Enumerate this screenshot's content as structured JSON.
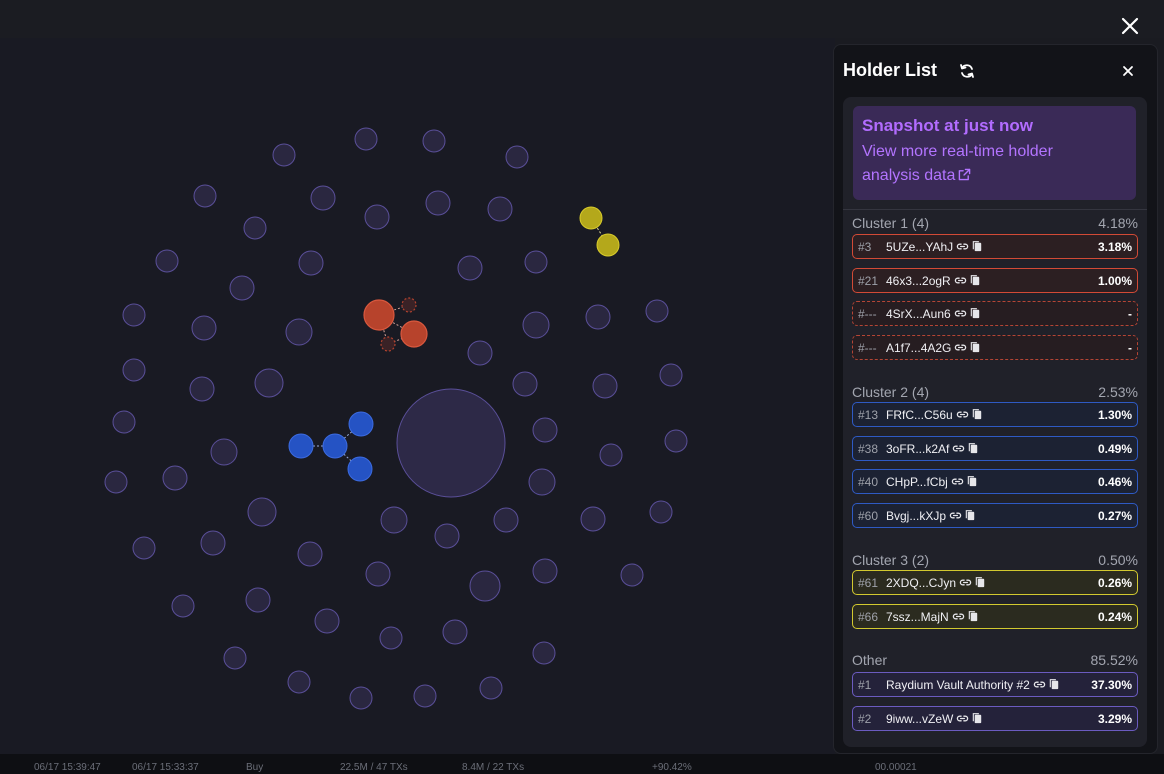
{
  "panel": {
    "title": "Holder List"
  },
  "snapshot": {
    "title": "Snapshot at just now",
    "link_text": "View more real-time holder analysis data"
  },
  "clusters": [
    {
      "label": "Cluster 1 (4)",
      "pct": "4.18%",
      "color": "#d24a36",
      "holders": [
        {
          "rank": "#3",
          "address": "5UZe...YAhJ",
          "value": "3.18%",
          "style": "red"
        },
        {
          "rank": "#21",
          "address": "46x3...2ogR",
          "value": "1.00%",
          "style": "red"
        },
        {
          "rank": "#---",
          "address": "4SrX...Aun6",
          "value": "-",
          "style": "red-dash"
        },
        {
          "rank": "#---",
          "address": "A1f7...4A2G",
          "value": "-",
          "style": "red-dash"
        }
      ]
    },
    {
      "label": "Cluster 2 (4)",
      "pct": "2.53%",
      "color": "#2e5ac4",
      "holders": [
        {
          "rank": "#13",
          "address": "FRfC...C56u",
          "value": "1.30%",
          "style": "blue"
        },
        {
          "rank": "#38",
          "address": "3oFR...k2Af",
          "value": "0.49%",
          "style": "blue"
        },
        {
          "rank": "#40",
          "address": "CHpP...fCbj",
          "value": "0.46%",
          "style": "blue"
        },
        {
          "rank": "#60",
          "address": "Bvgj...kXJp",
          "value": "0.27%",
          "style": "blue"
        }
      ]
    },
    {
      "label": "Cluster 3 (2)",
      "pct": "0.50%",
      "color": "#d2c92f",
      "holders": [
        {
          "rank": "#61",
          "address": "2XDQ...CJyn",
          "value": "0.26%",
          "style": "yellow"
        },
        {
          "rank": "#66",
          "address": "7ssz...MajN",
          "value": "0.24%",
          "style": "yellow"
        }
      ]
    },
    {
      "label": "Other",
      "pct": "85.52%",
      "color": "#6b5bc0",
      "holders": [
        {
          "rank": "#1",
          "address": "Raydium Vault Authority #2",
          "value": "37.30%",
          "style": "purple"
        },
        {
          "rank": "#2",
          "address": "9iww...vZeW",
          "value": "3.29%",
          "style": "purple"
        }
      ]
    }
  ],
  "icons": {
    "close": "close-icon",
    "refresh": "refresh-icon",
    "external_link": "external-link-icon",
    "link": "link-icon",
    "copy": "copy-icon"
  },
  "colors": {
    "accent_purple": "#b26cff",
    "cluster_red": "#d24a36",
    "cluster_blue": "#2e5ac4",
    "cluster_yellow": "#d2c92f",
    "other_bubble": "#2e2a4a"
  },
  "background_strip": [
    "06/17 15:39:47",
    "06/17 15:33:37",
    "Buy",
    "22.5M / 47 TXs",
    "8.4M / 22 TXs",
    "+90.42%",
    "00.00021"
  ]
}
